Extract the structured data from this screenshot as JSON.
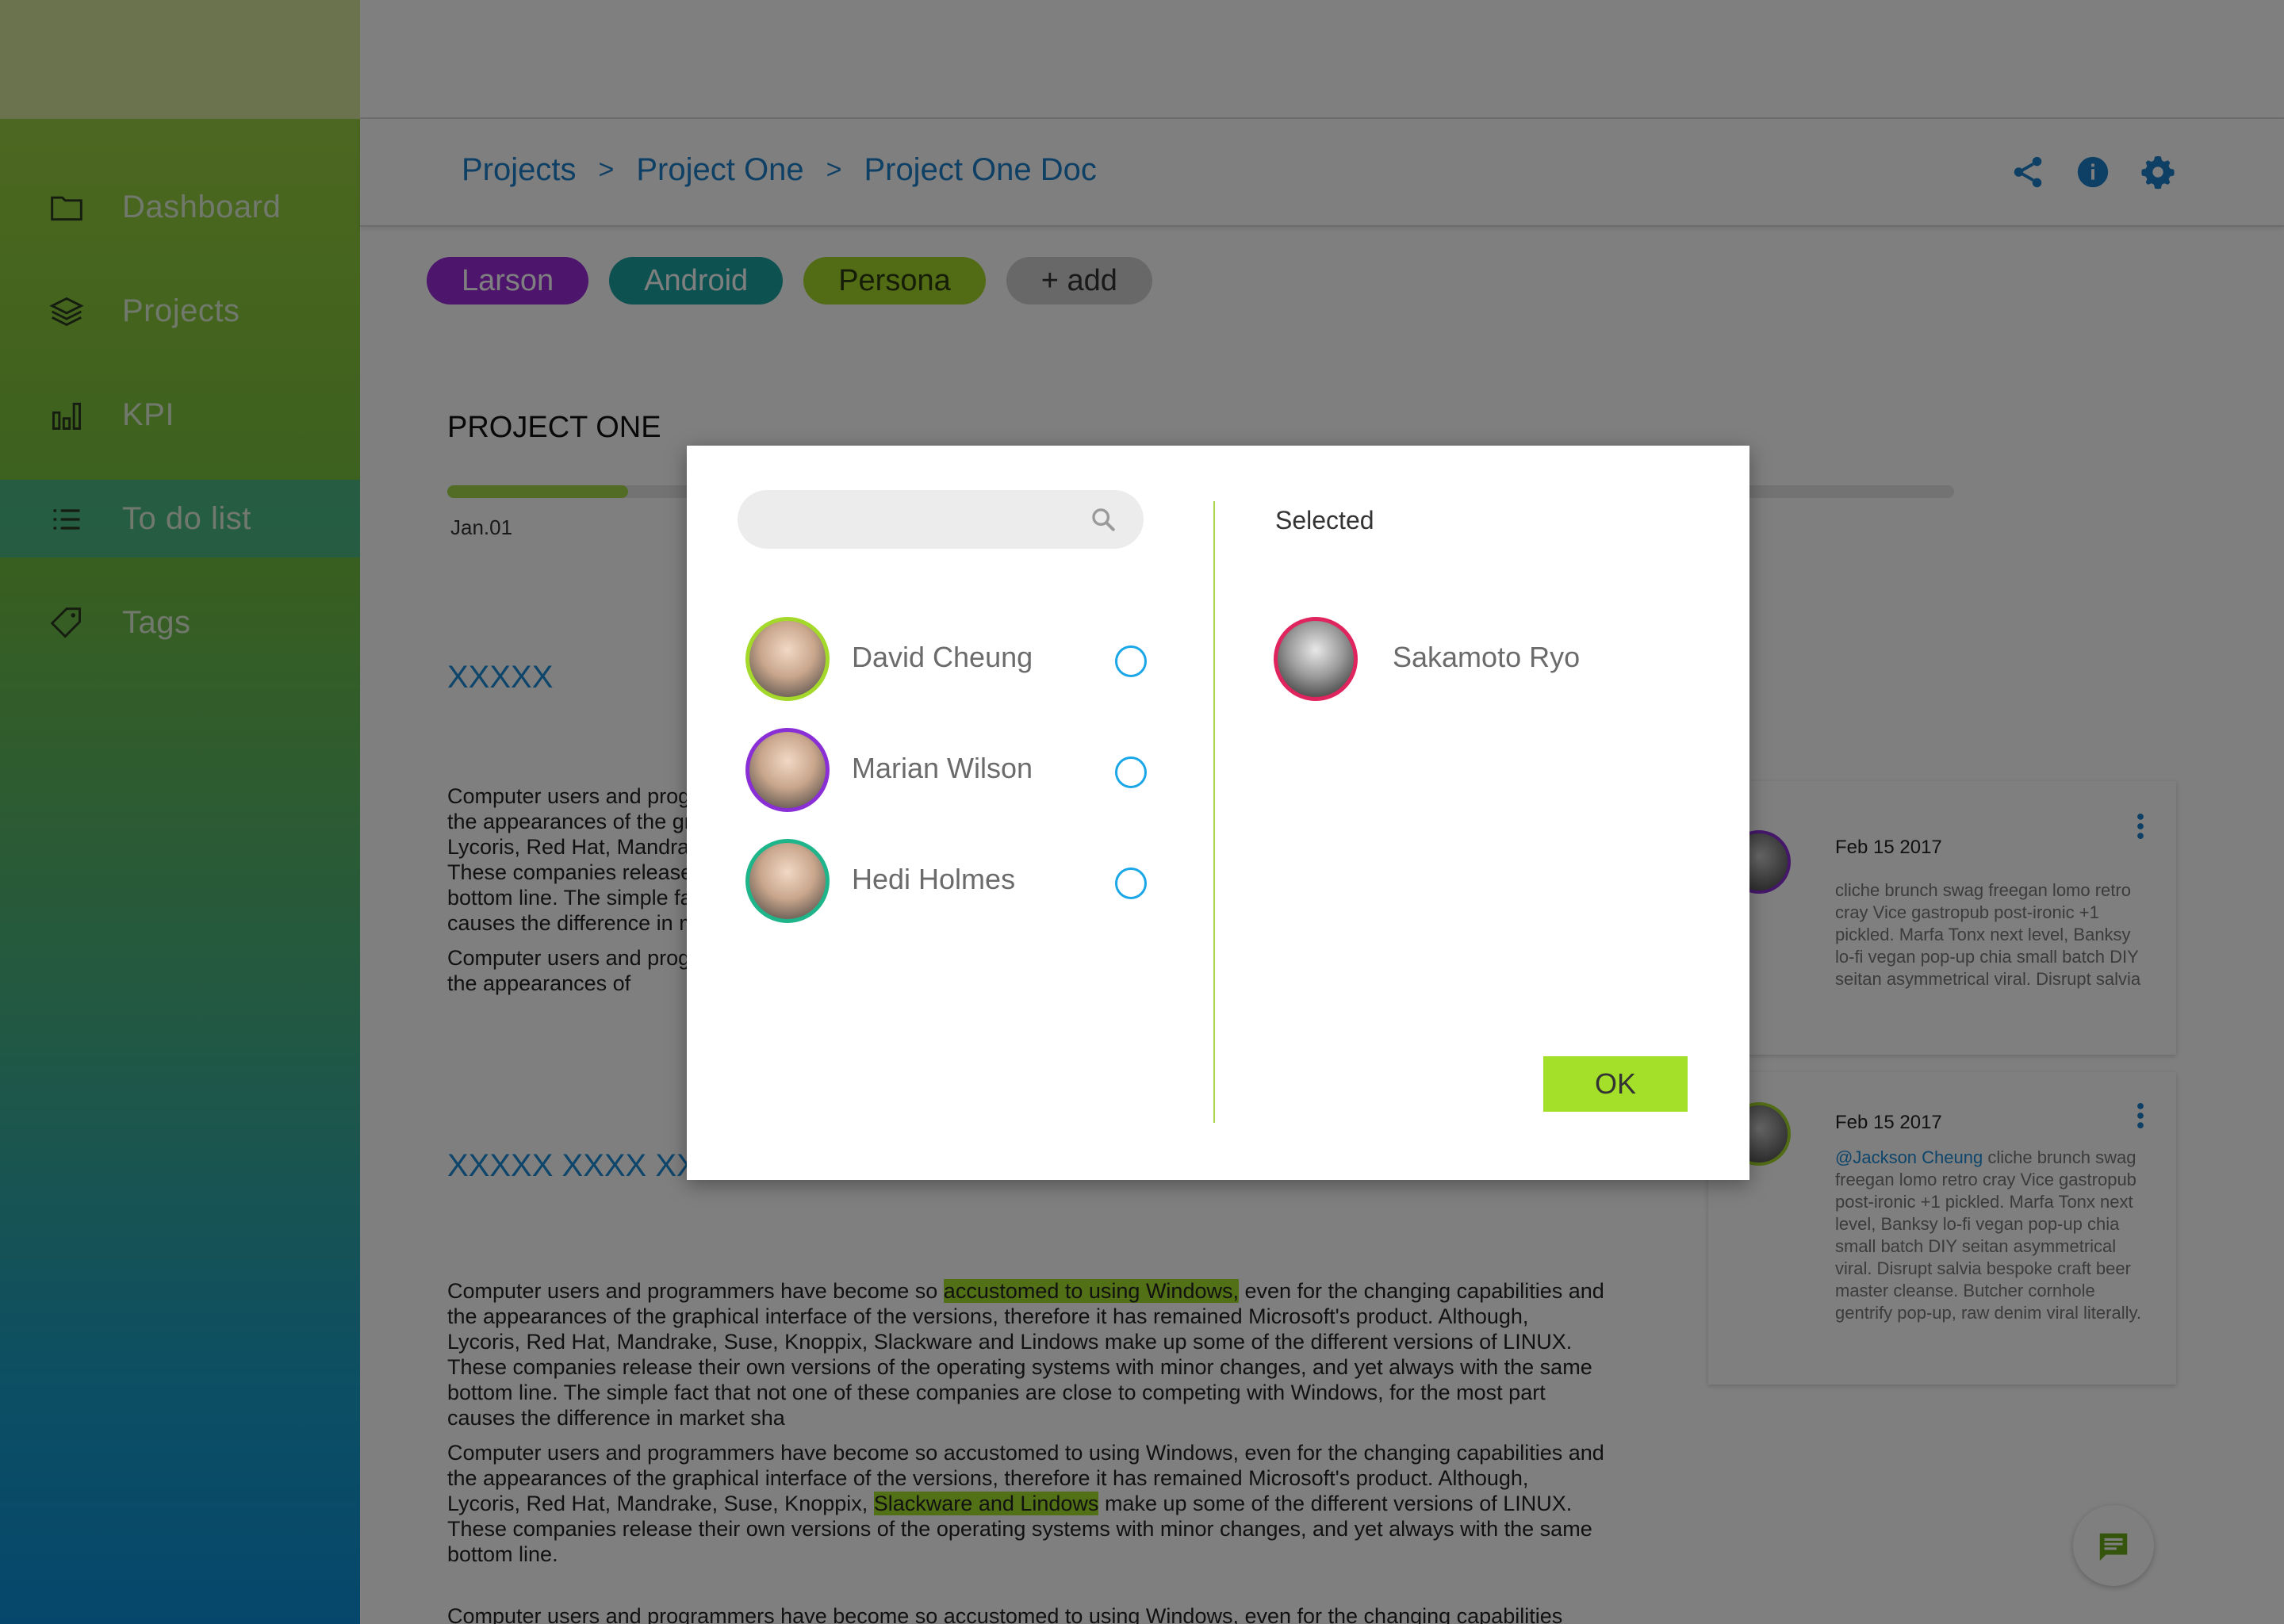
{
  "sidebar": {
    "items": [
      {
        "label": "Dashboard",
        "icon": "folder-icon"
      },
      {
        "label": "Projects",
        "icon": "layers-icon"
      },
      {
        "label": "KPI",
        "icon": "bar-chart-icon"
      },
      {
        "label": "To do list",
        "icon": "list-icon",
        "active": true
      },
      {
        "label": "Tags",
        "icon": "tag-icon"
      }
    ]
  },
  "breadcrumb": {
    "items": [
      "Projects",
      "Project One",
      "Project One Doc"
    ],
    "separator": ">"
  },
  "header_actions": [
    "share-icon",
    "info-icon",
    "settings-icon"
  ],
  "tags": [
    {
      "label": "Larson",
      "color": "#9b2cd8"
    },
    {
      "label": "Android",
      "color": "#1aa3a3"
    },
    {
      "label": "Persona",
      "color": "#a4d82a"
    },
    {
      "label": "+ add",
      "color": "#d0d0d0"
    }
  ],
  "project": {
    "title": "PROJECT ONE",
    "progress_start_label": "Jan.01",
    "progress": 0.12
  },
  "document": {
    "heading1": "XXXXX",
    "heading2": "XXXXX XXXX XXXX",
    "para1a": "Computer users and programmers have become so accustomed to using Windows, even for the changing capabilities and the appearances of the graphical interface of the versions, therefore it has remained Microsoft's product. Although, Lycoris, Red Hat, Mandrake, Suse, Knoppix, Slackware and Lindows make up some of the different versions of LINUX. These companies release their own versions of the operating systems with minor changes, and yet always with the same bottom line. The simple fact that not one of these companies are close to competing with Windows, for the most part causes the difference in market sha",
    "para1b": "Computer users and programmers have become so accustomed to using Windows, even for the changing capabilities and the appearances of",
    "para2_pre": "Computer users and programmers have become so ",
    "para2_hl": "accustomed to using Windows,",
    "para2_post": " even for the changing capabilities and the appearances of the graphical interface of the versions, therefore it has remained Microsoft's product. Although, Lycoris, Red Hat, Mandrake, Suse, Knoppix, Slackware and Lindows make up some of the different versions of LINUX. These companies release their own versions of the operating systems with minor changes, and yet always with the same bottom line. The simple fact that not one of these companies are close to competing with Windows, for the most part causes the difference in market sha",
    "para3_pre": "Computer users and programmers have become so accustomed to using Windows, even for the changing capabilities and the appearances of the graphical interface of the versions, therefore it has remained Microsoft's product. Although, Lycoris, Red Hat, Mandrake, Suse, Knoppix, ",
    "para3_hl": "Slackware and Lindows",
    "para3_post": " make up some of the different versions of LINUX. These companies release their own versions of the operating systems with minor changes, and yet always with the same bottom line.",
    "para4": "Computer users and programmers have become so accustomed to using Windows, even for the changing capabilities"
  },
  "comments": [
    {
      "date": "Feb 15 2017",
      "avatar_border": "#8a2ed6",
      "mention": "",
      "text": "cliche brunch swag freegan lomo retro cray Vice gastropub post-ironic +1 pickled. Marfa Tonx next level, Banksy lo-fi vegan pop-up chia small batch DIY seitan asymmetrical viral. Disrupt salvia"
    },
    {
      "date": "Feb 15 2017",
      "avatar_border": "#a4d82a",
      "mention": "@Jackson Cheung",
      "text": " cliche brunch swag freegan lomo retro cray Vice gastropub post-ironic +1 pickled. Marfa Tonx next level, Banksy lo-fi vegan pop-up chia small batch DIY seitan asymmetrical viral. Disrupt salvia bespoke craft beer master cleanse. Butcher cornhole gentrify pop-up, raw denim viral literally."
    }
  ],
  "modal": {
    "search": {
      "value": "",
      "placeholder": ""
    },
    "people": [
      {
        "name": "David Cheung",
        "border": "#a4d82a"
      },
      {
        "name": "Marian Wilson",
        "border": "#8a2ed6"
      },
      {
        "name": "Hedi Holmes",
        "border": "#1fb58a"
      }
    ],
    "selected_title": "Selected",
    "selected": [
      {
        "name": "Sakamoto Ryo",
        "border": "#e0245e"
      }
    ],
    "ok_label": "OK"
  },
  "colors": {
    "accent": "#1d7fc8",
    "green": "#a4e02a",
    "radio": "#1aa7e8"
  }
}
